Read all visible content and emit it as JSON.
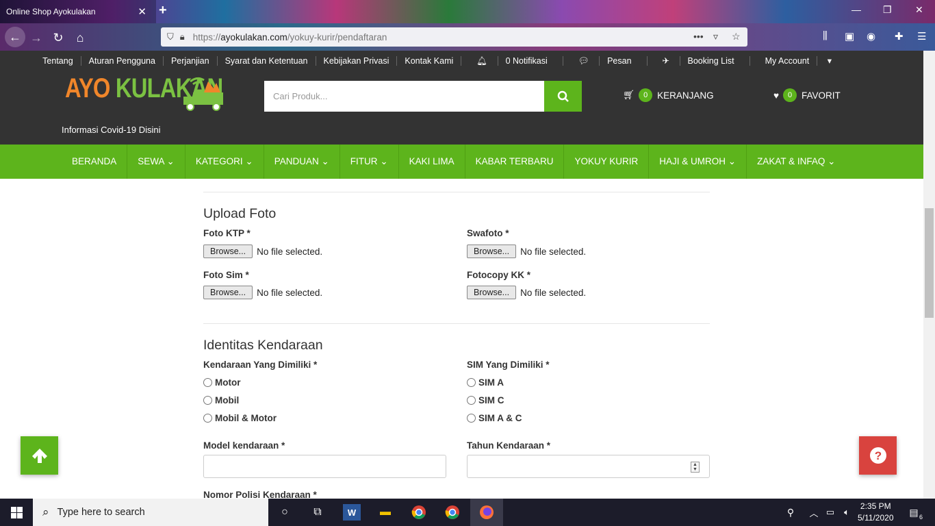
{
  "browser": {
    "tab_title": "Online Shop Ayokulakan",
    "url_prefix": "https://",
    "url_domain": "ayokulakan.com",
    "url_path": "/yokuy-kurir/pendaftaran"
  },
  "toplinks": [
    "Tentang",
    "Aturan Pengguna",
    "Perjanjian",
    "Syarat dan Ketentuan",
    "Kebijakan Privasi",
    "Kontak Kami",
    "0 Notifikasi",
    "Pesan",
    "Booking List",
    "My Account"
  ],
  "logo": {
    "part1": "AYO",
    "part2": "KULAKAN"
  },
  "info_link": "Informasi Covid-19 Disini",
  "search": {
    "placeholder": "Cari Produk..."
  },
  "cart": {
    "count": "0",
    "label": "KERANJANG"
  },
  "favorite": {
    "count": "0",
    "label": "FAVORIT"
  },
  "menu": [
    "BERANDA",
    "SEWA",
    "KATEGORI",
    "PANDUAN",
    "FITUR",
    "KAKI LIMA",
    "KABAR TERBARU",
    "YOKUY KURIR",
    "HAJI & UMROH",
    "ZAKAT & INFAQ"
  ],
  "upload": {
    "title": "Upload Foto",
    "browse": "Browse...",
    "no_file": "No file selected.",
    "fields": [
      "Foto KTP *",
      "Swafoto *",
      "Foto Sim *",
      "Fotocopy KK *"
    ]
  },
  "vehicle": {
    "title": "Identitas Kendaraan",
    "owned_label": "Kendaraan Yang Dimiliki *",
    "owned_options": [
      "Motor",
      "Mobil",
      "Mobil & Motor"
    ],
    "sim_label": "SIM Yang Dimiliki *",
    "sim_options": [
      "SIM A",
      "SIM C",
      "SIM A & C"
    ],
    "model_label": "Model kendaraan *",
    "year_label": "Tahun Kendaraan *",
    "plate_label": "Nomor Polisi Kendaraan *"
  },
  "taskbar": {
    "search_text": "Type here to search",
    "time": "2:35 PM",
    "date": "5/11/2020",
    "notif_count": "6"
  },
  "colors": {
    "brand_green": "#5db41c",
    "header_dark": "#333333",
    "logo_orange": "#f0862a",
    "help_red": "#d9433e"
  }
}
